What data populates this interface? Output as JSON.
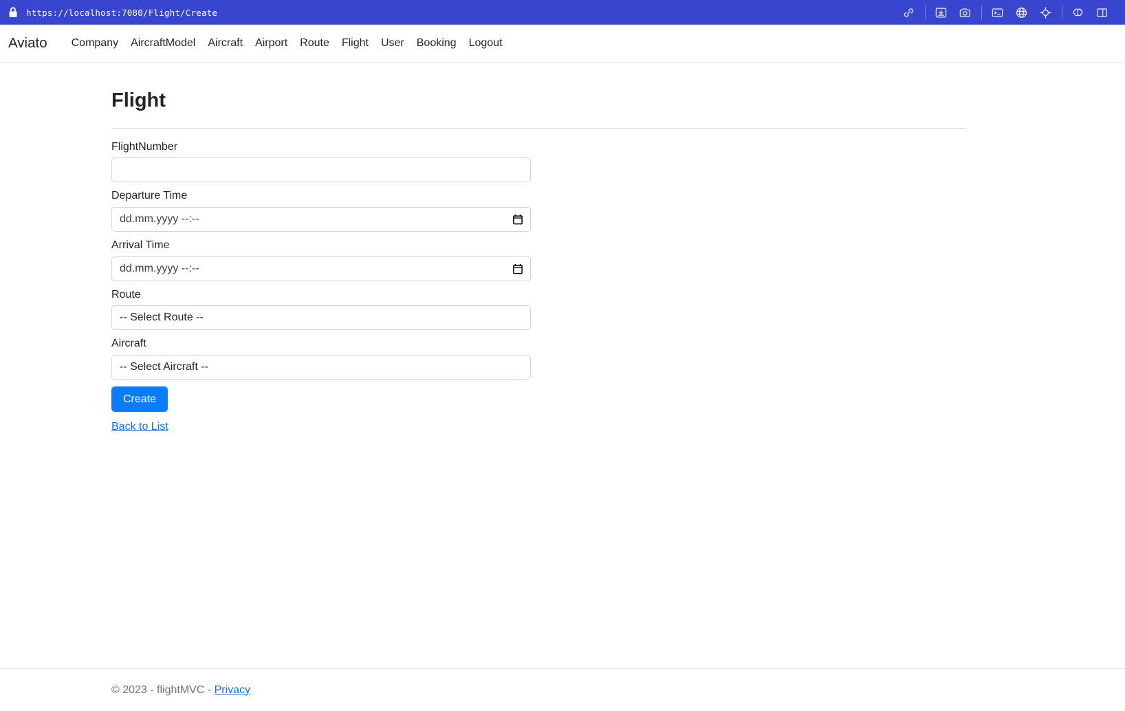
{
  "browser": {
    "url": "https://localhost:7080/Flight/Create",
    "lock_icon": "lock-icon",
    "toolbar_groups": [
      {
        "icons": [
          {
            "name": "link-icon"
          }
        ]
      },
      {
        "icons": [
          {
            "name": "save-to-box-icon"
          },
          {
            "name": "camera-icon"
          }
        ]
      },
      {
        "icons": [
          {
            "name": "terminal-icon"
          },
          {
            "name": "globe-icon"
          },
          {
            "name": "target-crosshair-icon"
          }
        ]
      },
      {
        "icons": [
          {
            "name": "brain-icon"
          },
          {
            "name": "split-panel-icon"
          }
        ]
      }
    ]
  },
  "navbar": {
    "brand": "Aviato",
    "links": [
      {
        "label": "Company"
      },
      {
        "label": "AircraftModel"
      },
      {
        "label": "Aircraft"
      },
      {
        "label": "Airport"
      },
      {
        "label": "Route"
      },
      {
        "label": "Flight"
      },
      {
        "label": "User"
      },
      {
        "label": "Booking"
      },
      {
        "label": "Logout"
      }
    ]
  },
  "main": {
    "title": "Flight",
    "fields": {
      "flight_number": {
        "label": "FlightNumber",
        "value": "",
        "placeholder": ""
      },
      "departure_time": {
        "label": "Departure Time",
        "value": "",
        "placeholder": "dd.mm.yyyy --:--"
      },
      "arrival_time": {
        "label": "Arrival Time",
        "value": "",
        "placeholder": "dd.mm.yyyy --:--"
      },
      "route": {
        "label": "Route",
        "selected": "-- Select Route --",
        "options": [
          "-- Select Route --"
        ]
      },
      "aircraft": {
        "label": "Aircraft",
        "selected": "-- Select Aircraft --",
        "options": [
          "-- Select Aircraft --"
        ]
      }
    },
    "submit_label": "Create",
    "back_link_label": "Back to List"
  },
  "footer": {
    "copyright": "© 2023 - flightMVC - ",
    "privacy_label": "Privacy"
  },
  "colors": {
    "urlbar_blue": "#3845cf",
    "primary_button": "#0b7cfb",
    "link_blue": "#0d6efd",
    "border_gray": "#ced4da",
    "muted_text": "#6c757d"
  }
}
